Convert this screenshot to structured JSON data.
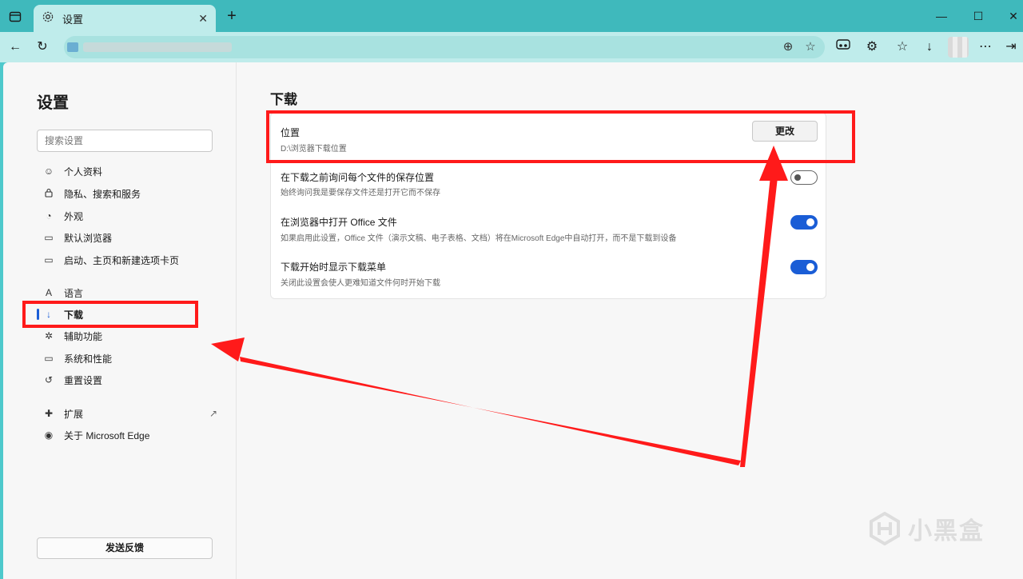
{
  "tab": {
    "title": "设置",
    "close": "✕",
    "new_tab": "+"
  },
  "window_controls": {
    "minimize": "—",
    "maximize": "☐",
    "close": "✕"
  },
  "toolbar": {
    "back": "←",
    "refresh": "↻"
  },
  "sidebar": {
    "title": "设置",
    "search_placeholder": "搜索设置",
    "items": [
      {
        "label": "个人资料",
        "icon": "profile-icon",
        "glyph": "☺"
      },
      {
        "label": "隐私、搜索和服务",
        "icon": "lock-icon",
        "glyph": "🔒"
      },
      {
        "label": "外观",
        "icon": "appearance-icon",
        "glyph": "◔"
      },
      {
        "label": "默认浏览器",
        "icon": "browser-icon",
        "glyph": "▭"
      },
      {
        "label": "启动、主页和新建选项卡页",
        "icon": "home-icon",
        "glyph": "▭"
      },
      {
        "label": "语言",
        "icon": "language-icon",
        "glyph": "A"
      },
      {
        "label": "下载",
        "icon": "download-icon",
        "glyph": "↓"
      },
      {
        "label": "辅助功能",
        "icon": "accessibility-icon",
        "glyph": "✲"
      },
      {
        "label": "系统和性能",
        "icon": "laptop-icon",
        "glyph": "▭"
      },
      {
        "label": "重置设置",
        "icon": "reset-icon",
        "glyph": "↺"
      },
      {
        "label": "扩展",
        "icon": "extensions-icon",
        "glyph": "✚"
      },
      {
        "label": "关于 Microsoft Edge",
        "icon": "edge-icon",
        "glyph": "◉"
      }
    ],
    "active_item": "下载",
    "external_link_glyph": "↗",
    "feedback_label": "发送反馈"
  },
  "main": {
    "title": "下载",
    "location": {
      "title": "位置",
      "path": "D:\\浏览器下载位置",
      "button": "更改"
    },
    "settings": [
      {
        "title": "在下载之前询问每个文件的保存位置",
        "desc": "始终询问我是要保存文件还是打开它而不保存",
        "enabled": false
      },
      {
        "title": "在浏览器中打开 Office 文件",
        "desc": "如果启用此设置，Office 文件（演示文稿、电子表格、文档）将在Microsoft Edge中自动打开，而不是下载到设备",
        "enabled": true
      },
      {
        "title": "下载开始时显示下载菜单",
        "desc": "关闭此设置会使人更难知道文件何时开始下载",
        "enabled": true
      }
    ]
  },
  "watermark": {
    "text": "小黑盒"
  },
  "colors": {
    "accent": "#1a5dd6",
    "annotation": "#ff1a1a",
    "frame": "#3fb9bc"
  }
}
